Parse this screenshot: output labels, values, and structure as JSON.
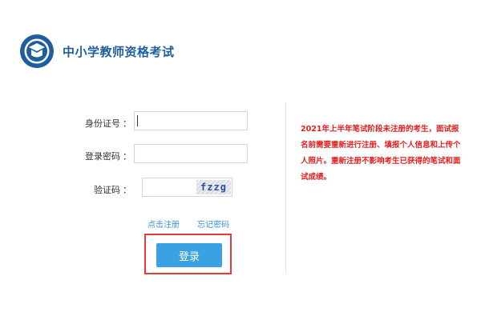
{
  "site": {
    "title": "中小学教师资格考试"
  },
  "form": {
    "id_label": "身份证号",
    "password_label": "登录密码",
    "captcha_label": "验证码",
    "colon": "：",
    "id_value": "",
    "password_value": "",
    "captcha_value": "",
    "captcha_image_text": "fzzg"
  },
  "links": {
    "register": "点击注册",
    "forgot": "忘记密码"
  },
  "login_button": "登录",
  "notice": "2021年上半年笔试阶段未注册的考生，面试报名前需要重新进行注册、填报个人信息和上传个人照片。重新注册不影响考生已获得的笔试和面试成绩。",
  "colors": {
    "accent": "#3aa2e2",
    "notice": "#e31f1f",
    "brand": "#1f5e9e",
    "highlight": "#e23b3b"
  },
  "icons": {
    "logo": "education-emblem-icon"
  }
}
